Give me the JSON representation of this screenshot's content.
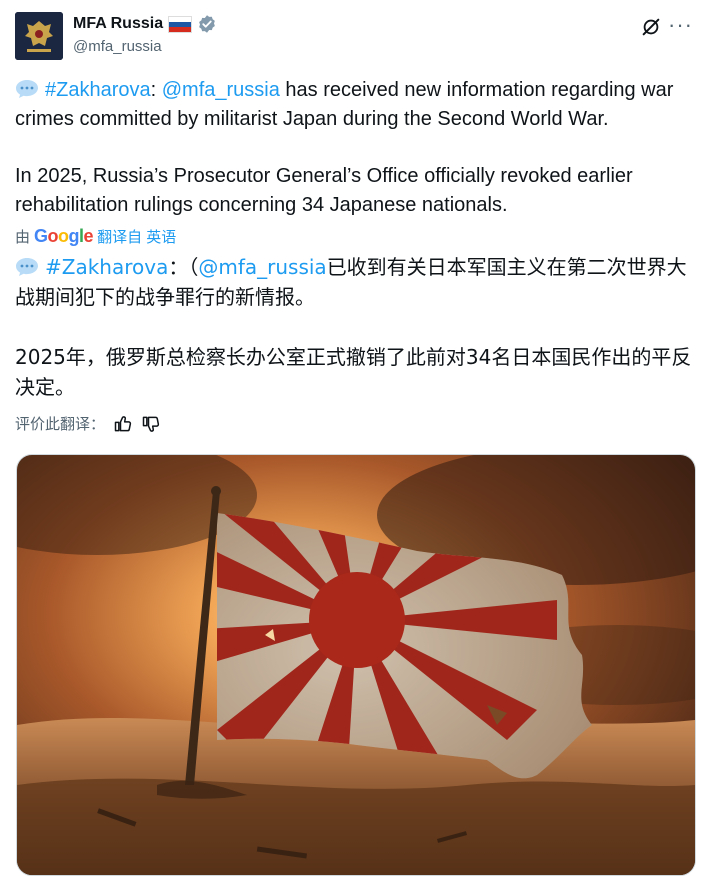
{
  "account": {
    "name": "MFA Russia",
    "handle": "@mfa_russia"
  },
  "icons": {
    "avatar": "russian-coat-of-arms",
    "flag": "russia-flag",
    "verified": "verified-badge-icon",
    "grok": "grok-icon",
    "more": "more-icon",
    "speech": "speech-balloon-icon",
    "thumb_up": "thumbs-up-icon",
    "thumb_down": "thumbs-down-icon"
  },
  "colors": {
    "link": "#1d9bf0",
    "text": "#0f1419",
    "secondary": "#536471"
  },
  "post": {
    "hashtag": "#Zakharova",
    "colon": ":",
    "mention": "@mfa_russia",
    "line1_rest": " has received new information regarding war crimes committed by militarist Japan during the Second World War.",
    "paragraph2": "In 2025, Russia’s Prosecutor General’s Office officially revoked earlier rehabilitation rulings concerning 34 Japanese nationals."
  },
  "translation_bar": {
    "by": "由",
    "google": "Google",
    "translated_from": "翻译自 英语"
  },
  "translated": {
    "hashtag": "#Zakharova",
    "sep": "：（",
    "mention": "@mfa_russia",
    "line1_rest": "已收到有关日本军国主义在第二次世界大战期间犯下的战争罪行的新情报。",
    "paragraph2": "2025年，俄罗斯总检察长办公室正式撤销了此前对34名日本国民作出的平反决定。"
  },
  "rate_translation": {
    "label": "评价此翻译："
  }
}
